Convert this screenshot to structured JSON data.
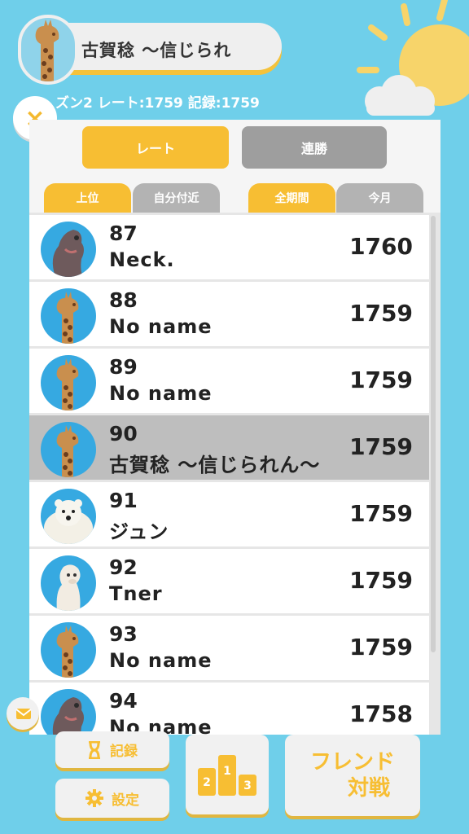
{
  "header": {
    "player_name": "古賀稔 ～信じられ",
    "season_line": "ズン2  レート:1759  記録:1759",
    "close_label": "×"
  },
  "tabs": {
    "mode": [
      {
        "label": "レート",
        "active": true
      },
      {
        "label": "連勝",
        "active": false
      }
    ],
    "scope": [
      {
        "label": "上位",
        "active": true
      },
      {
        "label": "自分付近",
        "active": false
      }
    ],
    "period": [
      {
        "label": "全期間",
        "active": true
      },
      {
        "label": "今月",
        "active": false
      }
    ]
  },
  "ranking": [
    {
      "rank": "87",
      "name": "Neck.",
      "score": "1760",
      "avatar": "hippo",
      "highlight": false
    },
    {
      "rank": "88",
      "name": "No name",
      "score": "1759",
      "avatar": "giraffe",
      "highlight": false
    },
    {
      "rank": "89",
      "name": "No name",
      "score": "1759",
      "avatar": "giraffe",
      "highlight": false
    },
    {
      "rank": "90",
      "name": "古賀稔 ～信じられん～",
      "score": "1759",
      "avatar": "giraffe",
      "highlight": true
    },
    {
      "rank": "91",
      "name": "ジュン",
      "score": "1759",
      "avatar": "polar-bear",
      "highlight": false
    },
    {
      "rank": "92",
      "name": "Tner",
      "score": "1759",
      "avatar": "alpaca",
      "highlight": false
    },
    {
      "rank": "93",
      "name": "No name",
      "score": "1759",
      "avatar": "giraffe",
      "highlight": false
    },
    {
      "rank": "94",
      "name": "No name",
      "score": "1758",
      "avatar": "hippo",
      "highlight": false
    }
  ],
  "bottom": {
    "record_label": "記録",
    "settings_label": "設定",
    "podium_numbers": [
      "2",
      "1",
      "3"
    ],
    "friend_line1": "フレンド",
    "friend_line2": "対戦"
  },
  "colors": {
    "background": "#6FCFEA",
    "accent": "#F7BE33",
    "inactive": "#9E9E9E",
    "highlight_row": "#BEBEBE"
  }
}
